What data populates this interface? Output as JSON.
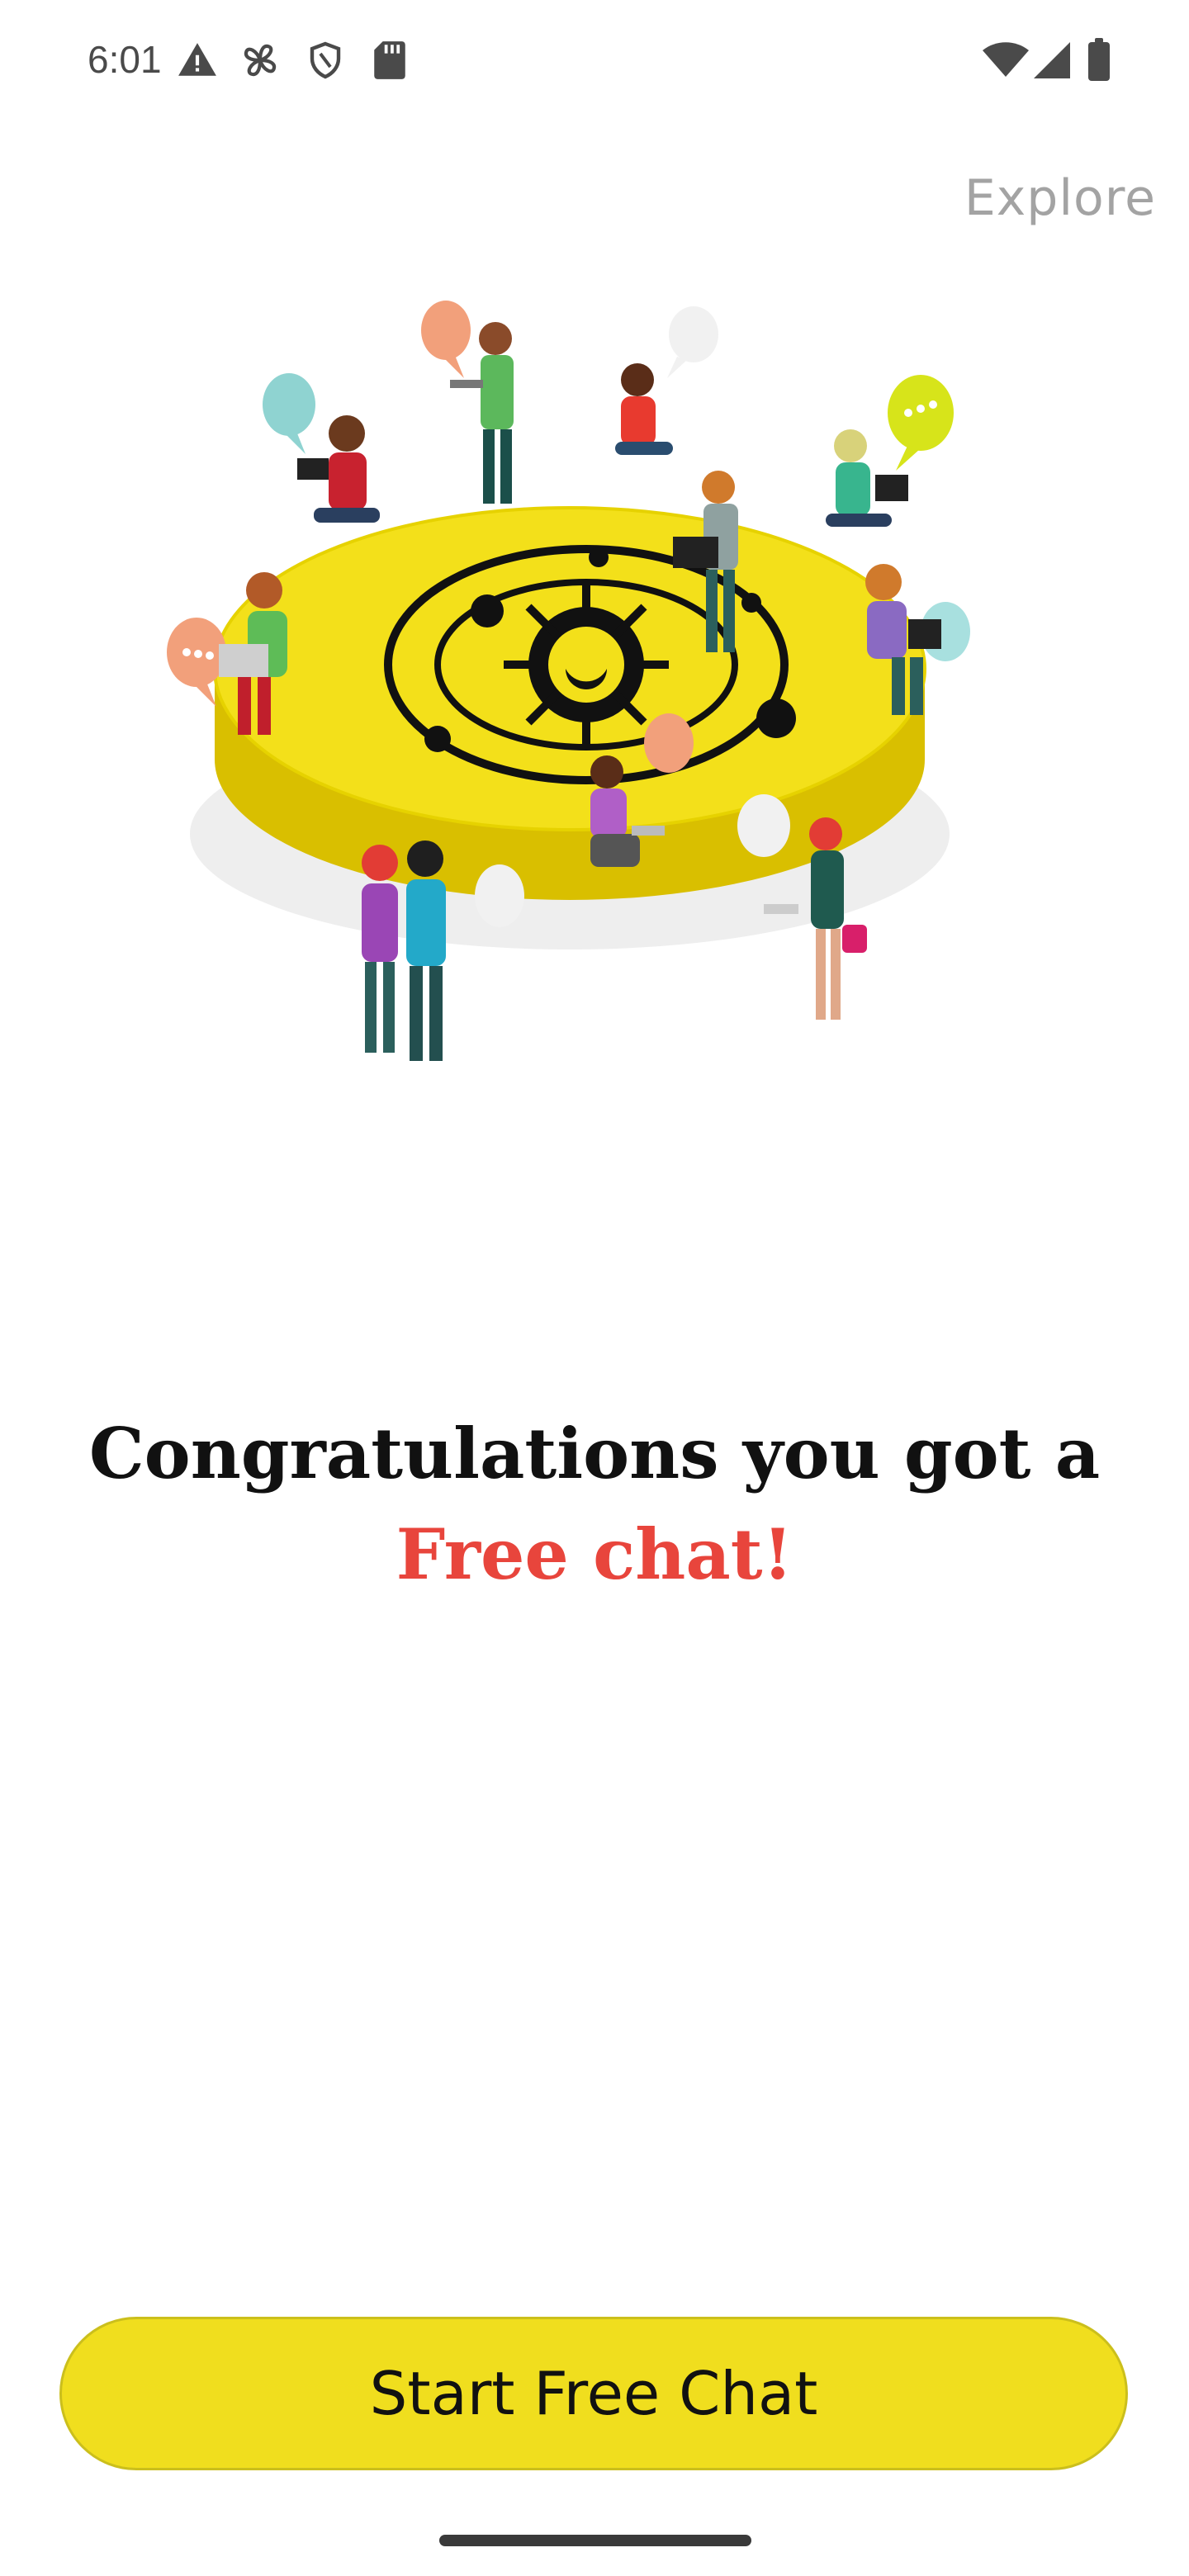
{
  "status_bar": {
    "time": "6:01",
    "left_icons": [
      "warning-icon",
      "fan-icon",
      "shield-icon",
      "sd-card-icon"
    ],
    "right_icons": [
      "wifi-icon",
      "signal-icon",
      "battery-icon"
    ]
  },
  "header": {
    "explore_label": "Explore"
  },
  "illustration": {
    "platform_color": "#f3e01a",
    "symbol": "sun-and-planets-icon"
  },
  "headline": {
    "line1": "Congratulations you got a",
    "line2": "Free chat!",
    "highlight_color": "#e8453c"
  },
  "cta": {
    "label": "Start Free Chat",
    "color": "#f0de1e"
  }
}
